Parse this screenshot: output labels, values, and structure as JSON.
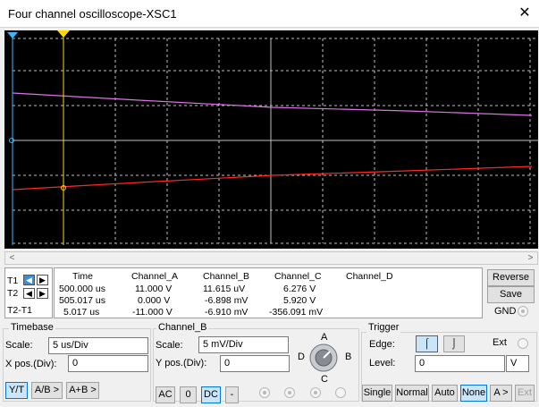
{
  "window": {
    "title": "Four channel oscilloscope-XSC1",
    "close_glyph": "✕"
  },
  "colors": {
    "channel_a_trace": "#ff2828",
    "channel_b_trace": "#e070e8",
    "cursor_t1": "#38b8ff",
    "cursor_t2": "#ffd800",
    "grid": "#ffffff",
    "screen": "#000000"
  },
  "cursors": {
    "t1_label": "T1",
    "t2_label": "T2",
    "delta_label": "T2-T1"
  },
  "readout": {
    "headers": [
      "Time",
      "Channel_A",
      "Channel_B",
      "Channel_C",
      "Channel_D"
    ],
    "rows": [
      [
        "500.000 us",
        "11.000 V",
        "11.615 uV",
        "6.276 V",
        ""
      ],
      [
        "505.017 us",
        "0.000 V",
        "-6.898 mV",
        "5.920 V",
        ""
      ],
      [
        "5.017 us",
        "-11.000 V",
        "-6.910 mV",
        "-356.091 mV",
        ""
      ]
    ]
  },
  "side_buttons": {
    "reverse": "Reverse",
    "save": "Save",
    "gnd": "GND"
  },
  "timebase": {
    "title": "Timebase",
    "scale_label": "Scale:",
    "scale_value": "5 us/Div",
    "xpos_label": "X pos.(Div):",
    "xpos_value": "0",
    "modes": [
      "Y/T",
      "A/B >",
      "A+B >"
    ]
  },
  "channel_b": {
    "title": "Channel_B",
    "scale_label": "Scale:",
    "scale_value": "5 mV/Div",
    "ypos_label": "Y pos.(Div):",
    "ypos_value": "0",
    "coupling": [
      "AC",
      "0",
      "DC",
      "-"
    ],
    "knob": {
      "a": "A",
      "b": "B",
      "c": "C",
      "d": "D"
    }
  },
  "trigger": {
    "title": "Trigger",
    "edge_label": "Edge:",
    "ext_label": "Ext",
    "level_label": "Level:",
    "level_value": "0",
    "level_unit": "V",
    "modes": [
      "Single",
      "Normal",
      "Auto",
      "None",
      "A >",
      "Ext"
    ]
  },
  "scroll": {
    "left": "<",
    "right": ">"
  }
}
